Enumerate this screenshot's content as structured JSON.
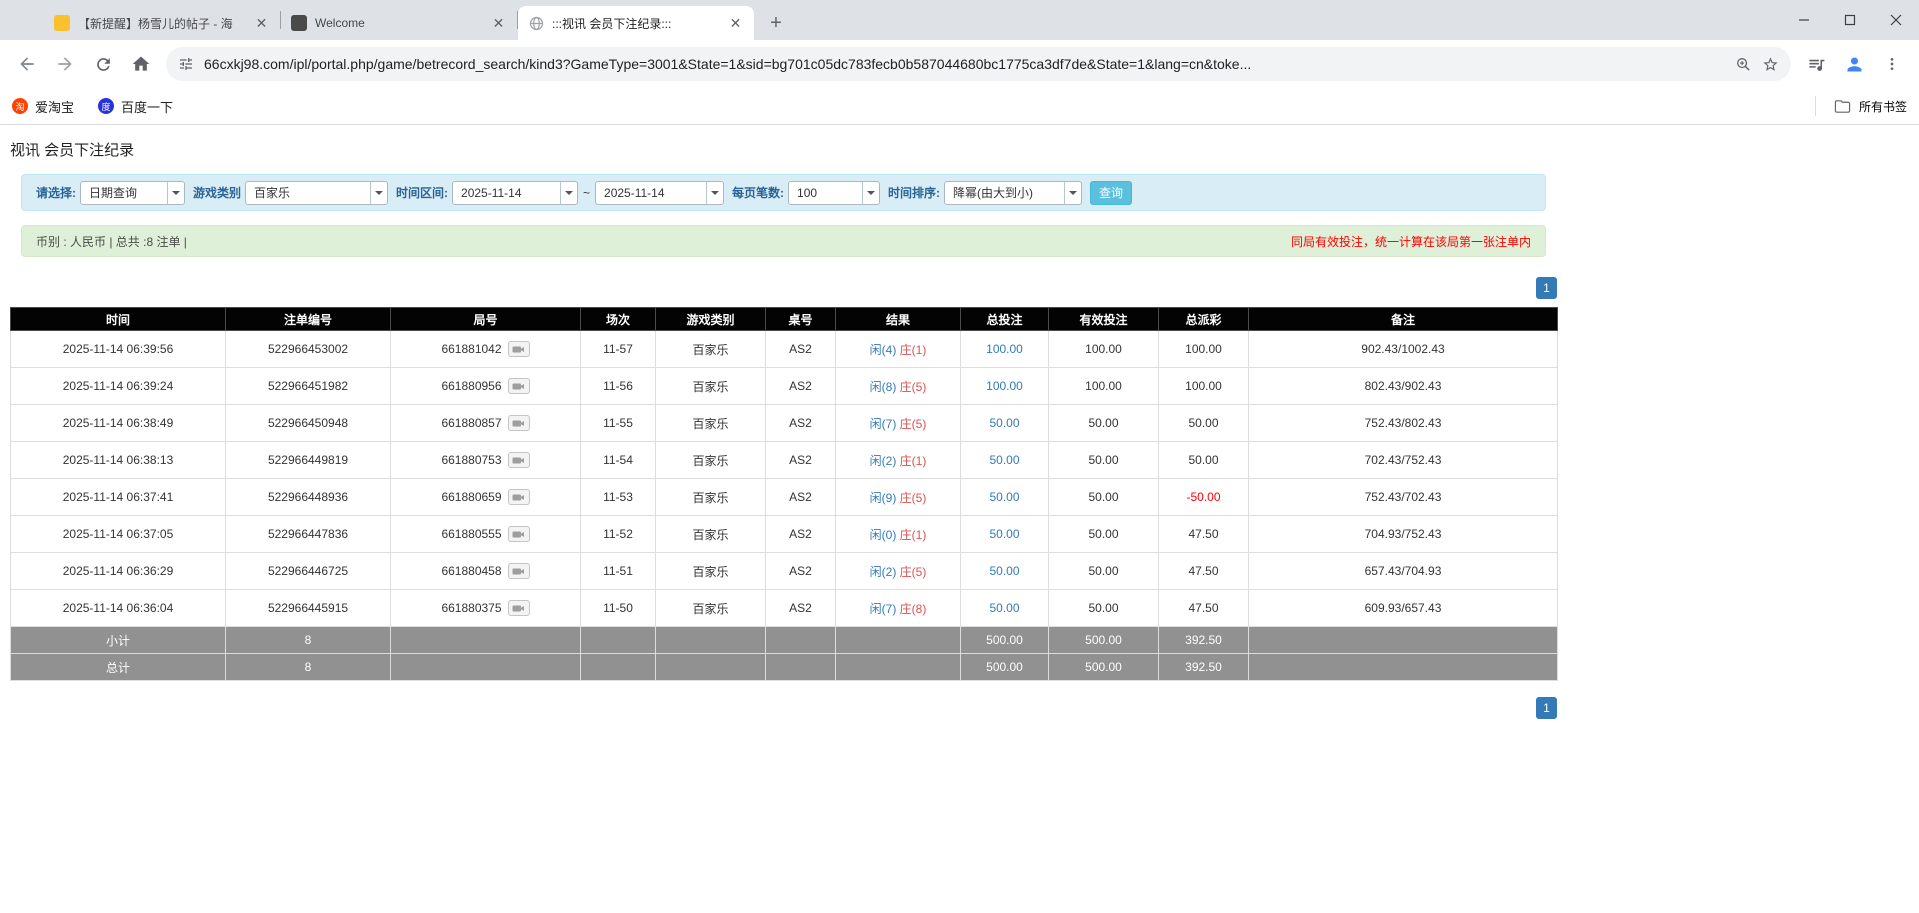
{
  "colors": {
    "accent_blue": "#337ab7",
    "player_blue": "#337ab7",
    "banker_red": "#d9534f",
    "negative_red": "#ff0000",
    "search_button_teal": "#5bc0de",
    "filter_bar_bg": "#d9edf7",
    "info_bar_bg": "#dff0d8",
    "table_header_bg": "#030303",
    "summary_row_bg": "#919191"
  },
  "browser": {
    "tabs": [
      {
        "title": "【新提醒】杨雪儿的帖子 - 海"
      },
      {
        "title": "Welcome"
      },
      {
        "title": ":::视讯 会员下注纪录:::"
      }
    ],
    "url": "66cxkj98.com/ipl/portal.php/game/betrecord_search/kind3?GameType=3001&State=1&sid=bg701c05dc783fecb0b587044680bc1775ca3df7de&State=1&lang=cn&toke...",
    "bookmarks": {
      "taobao": "爱淘宝",
      "baidu": "百度一下",
      "all_bookmarks": "所有书签"
    }
  },
  "page": {
    "title": "视讯 会员下注纪录",
    "filters": {
      "mode_label": "请选择:",
      "mode_value": "日期查询",
      "game_type_label": "游戏类别",
      "game_type_value": "百家乐",
      "range_label": "时间区间:",
      "date_from": "2025-11-14",
      "range_separator": "~",
      "date_to": "2025-11-14",
      "page_size_label": "每页笔数:",
      "page_size_value": "100",
      "sort_label": "时间排序:",
      "sort_value": "降幂(由大到小)",
      "search_button": "查询"
    },
    "info_bar": {
      "left": "币别 : 人民币 | 总共 :8 注单 |",
      "right": "同局有效投注，统一计算在该局第一张注单内"
    },
    "pagination": "1",
    "table": {
      "headers": [
        "时间",
        "注单编号",
        "局号",
        "场次",
        "游戏类别",
        "桌号",
        "结果",
        "总投注",
        "有效投注",
        "总派彩",
        "备注"
      ],
      "rows": [
        {
          "time": "2025-11-14 06:39:56",
          "bet_id": "522966453002",
          "round": "661881042",
          "session": "11-57",
          "game": "百家乐",
          "table": "AS2",
          "player": "闲(4)",
          "banker": "庄(1)",
          "total_bet": "100.00",
          "valid_bet": "100.00",
          "payout": "100.00",
          "note": "902.43/1002.43"
        },
        {
          "time": "2025-11-14 06:39:24",
          "bet_id": "522966451982",
          "round": "661880956",
          "session": "11-56",
          "game": "百家乐",
          "table": "AS2",
          "player": "闲(8)",
          "banker": "庄(5)",
          "total_bet": "100.00",
          "valid_bet": "100.00",
          "payout": "100.00",
          "note": "802.43/902.43"
        },
        {
          "time": "2025-11-14 06:38:49",
          "bet_id": "522966450948",
          "round": "661880857",
          "session": "11-55",
          "game": "百家乐",
          "table": "AS2",
          "player": "闲(7)",
          "banker": "庄(5)",
          "total_bet": "50.00",
          "valid_bet": "50.00",
          "payout": "50.00",
          "note": "752.43/802.43"
        },
        {
          "time": "2025-11-14 06:38:13",
          "bet_id": "522966449819",
          "round": "661880753",
          "session": "11-54",
          "game": "百家乐",
          "table": "AS2",
          "player": "闲(2)",
          "banker": "庄(1)",
          "total_bet": "50.00",
          "valid_bet": "50.00",
          "payout": "50.00",
          "note": "702.43/752.43"
        },
        {
          "time": "2025-11-14 06:37:41",
          "bet_id": "522966448936",
          "round": "661880659",
          "session": "11-53",
          "game": "百家乐",
          "table": "AS2",
          "player": "闲(9)",
          "banker": "庄(5)",
          "total_bet": "50.00",
          "valid_bet": "50.00",
          "payout": "-50.00",
          "note": "752.43/702.43"
        },
        {
          "time": "2025-11-14 06:37:05",
          "bet_id": "522966447836",
          "round": "661880555",
          "session": "11-52",
          "game": "百家乐",
          "table": "AS2",
          "player": "闲(0)",
          "banker": "庄(1)",
          "total_bet": "50.00",
          "valid_bet": "50.00",
          "payout": "47.50",
          "note": "704.93/752.43"
        },
        {
          "time": "2025-11-14 06:36:29",
          "bet_id": "522966446725",
          "round": "661880458",
          "session": "11-51",
          "game": "百家乐",
          "table": "AS2",
          "player": "闲(2)",
          "banker": "庄(5)",
          "total_bet": "50.00",
          "valid_bet": "50.00",
          "payout": "47.50",
          "note": "657.43/704.93"
        },
        {
          "time": "2025-11-14 06:36:04",
          "bet_id": "522966445915",
          "round": "661880375",
          "session": "11-50",
          "game": "百家乐",
          "table": "AS2",
          "player": "闲(7)",
          "banker": "庄(8)",
          "total_bet": "50.00",
          "valid_bet": "50.00",
          "payout": "47.50",
          "note": "609.93/657.43"
        }
      ],
      "subtotal": {
        "label": "小计",
        "count": "8",
        "total_bet": "500.00",
        "valid_bet": "500.00",
        "payout": "392.50"
      },
      "total": {
        "label": "总计",
        "count": "8",
        "total_bet": "500.00",
        "valid_bet": "500.00",
        "payout": "392.50"
      }
    }
  }
}
